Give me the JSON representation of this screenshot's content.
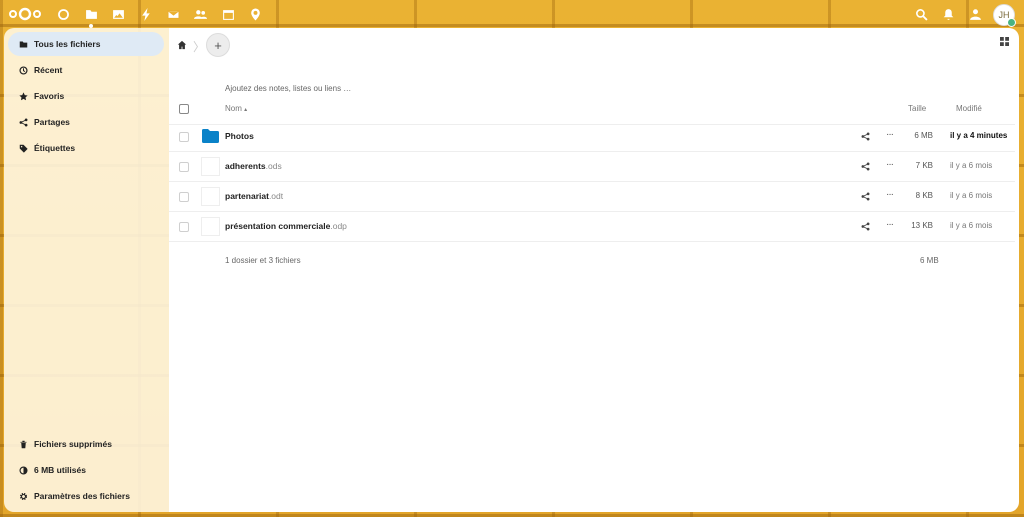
{
  "topbar": {
    "apps": [
      "dashboard",
      "files",
      "photos",
      "activity",
      "mail",
      "contacts",
      "calendar",
      "maps"
    ],
    "avatar_initials": "JH"
  },
  "sidebar": {
    "items": [
      {
        "label": "Tous les fichiers",
        "icon": "folder-icon"
      },
      {
        "label": "Récent",
        "icon": "clock-icon"
      },
      {
        "label": "Favoris",
        "icon": "star-icon"
      },
      {
        "label": "Partages",
        "icon": "share-icon"
      },
      {
        "label": "Étiquettes",
        "icon": "tag-icon"
      }
    ],
    "bottom": [
      {
        "label": "Fichiers supprimés",
        "icon": "trash-icon"
      },
      {
        "label": "6 MB utilisés",
        "icon": "quota-icon"
      },
      {
        "label": "Paramètres des fichiers",
        "icon": "gear-icon"
      }
    ]
  },
  "main": {
    "add_label": "+",
    "notes_placeholder": "Ajoutez des notes, listes ou liens …",
    "columns": {
      "name": "Nom",
      "sort_arrow": "▴",
      "size": "Taille",
      "modified": "Modifié"
    },
    "files": [
      {
        "name": "Photos",
        "ext": "",
        "type": "folder",
        "size": "6 MB",
        "modified": "il y a 4 minutes"
      },
      {
        "name": "adherents",
        "ext": ".ods",
        "type": "file",
        "size": "7 KB",
        "modified": "il y a 6 mois"
      },
      {
        "name": "partenariat",
        "ext": ".odt",
        "type": "file",
        "size": "8 KB",
        "modified": "il y a 6 mois"
      },
      {
        "name": "présentation commerciale",
        "ext": ".odp",
        "type": "file",
        "size": "13 KB",
        "modified": "il y a 6 mois"
      }
    ],
    "summary": "1 dossier et 3 fichiers",
    "summary_size": "6 MB"
  }
}
